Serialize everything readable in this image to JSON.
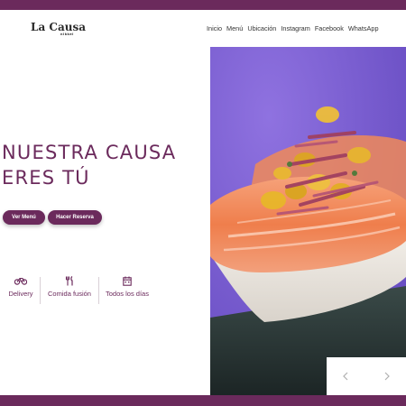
{
  "brand": {
    "logo_text": "La Causa",
    "logo_sub": "nikkei"
  },
  "nav": [
    "Inicio",
    "Menú",
    "Ubicación",
    "Instagram",
    "Facebook",
    "WhatsApp"
  ],
  "hero": {
    "line1": "NUESTRA CAUSA",
    "line2": "ERES TÚ"
  },
  "buttons": {
    "menu": "Ver Menú",
    "reserva": "Hacer Reserva"
  },
  "features": [
    {
      "label": "Delivery",
      "icon": "bicycle-icon"
    },
    {
      "label": "Comida fusión",
      "icon": "cutlery-icon"
    },
    {
      "label": "Todos los días",
      "icon": "calendar-icon"
    }
  ],
  "colors": {
    "brand": "#6b2a5c",
    "photo_bg": "#7a5fd0",
    "text": "#333333"
  }
}
